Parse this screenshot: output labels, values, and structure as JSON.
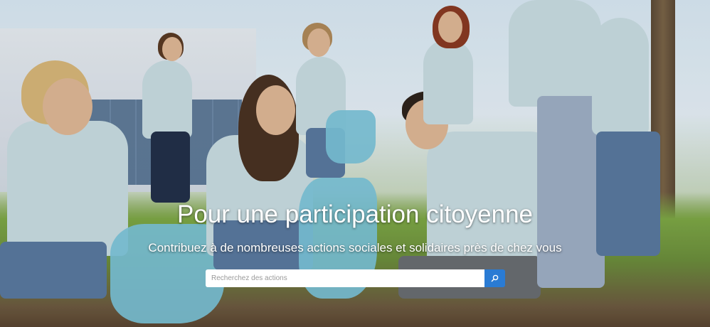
{
  "hero": {
    "title": "Pour une participation citoyenne",
    "subtitle": "Contribuez à de nombreuses actions sociales et solidaires près de chez vous"
  },
  "search": {
    "placeholder": "Recherchez des actions",
    "value": "",
    "button_icon": "search-icon",
    "button_color": "#2a7bd4"
  }
}
